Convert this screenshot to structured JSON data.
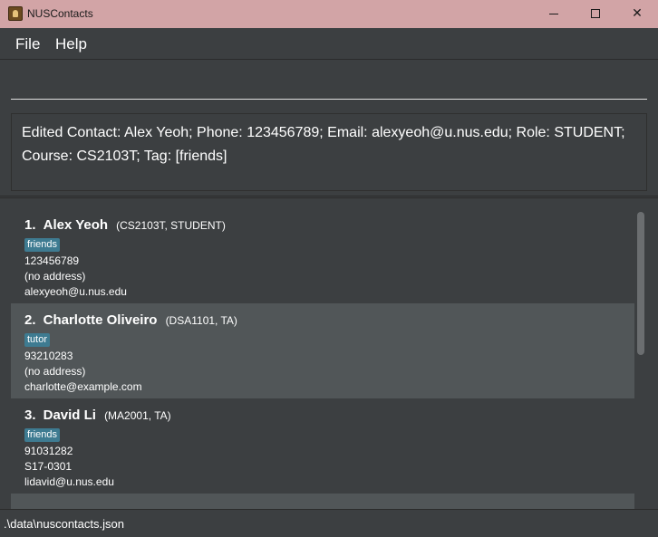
{
  "window": {
    "title": "NUSContacts"
  },
  "menu": {
    "file": "File",
    "help": "Help"
  },
  "command": {
    "value": "",
    "placeholder": ""
  },
  "result": {
    "message": "Edited Contact: Alex Yeoh; Phone: 123456789; Email: alexyeoh@u.nus.edu; Role: STUDENT; Course: CS2103T; Tag: [friends]"
  },
  "persons": [
    {
      "index": "1.",
      "name": "Alex Yeoh",
      "meta": "(CS2103T, STUDENT)",
      "tag": "friends",
      "phone": "123456789",
      "address": "(no address)",
      "email": "alexyeoh@u.nus.edu"
    },
    {
      "index": "2.",
      "name": "Charlotte Oliveiro",
      "meta": "(DSA1101, TA)",
      "tag": "tutor",
      "phone": "93210283",
      "address": "(no address)",
      "email": "charlotte@example.com"
    },
    {
      "index": "3.",
      "name": "David Li",
      "meta": "(MA2001, TA)",
      "tag": "friends",
      "phone": "91031282",
      "address": "S17-0301",
      "email": "lidavid@u.nus.edu"
    }
  ],
  "status": {
    "path": ".\\data\\nuscontacts.json"
  },
  "colors": {
    "titlebar": "#d2a4a6",
    "background": "#3c3f41",
    "card_alt": "#515658",
    "tag": "#3e7b91"
  }
}
